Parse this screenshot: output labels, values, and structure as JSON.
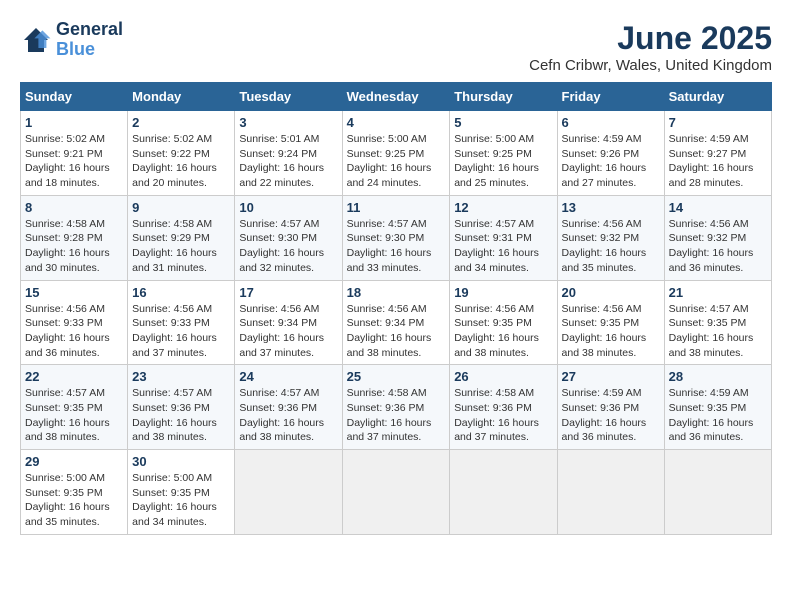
{
  "header": {
    "logo_line1": "General",
    "logo_line2": "Blue",
    "month": "June 2025",
    "location": "Cefn Cribwr, Wales, United Kingdom"
  },
  "weekdays": [
    "Sunday",
    "Monday",
    "Tuesday",
    "Wednesday",
    "Thursday",
    "Friday",
    "Saturday"
  ],
  "weeks": [
    [
      {
        "day": "1",
        "sunrise": "5:02 AM",
        "sunset": "9:21 PM",
        "daylight": "16 hours and 18 minutes."
      },
      {
        "day": "2",
        "sunrise": "5:02 AM",
        "sunset": "9:22 PM",
        "daylight": "16 hours and 20 minutes."
      },
      {
        "day": "3",
        "sunrise": "5:01 AM",
        "sunset": "9:24 PM",
        "daylight": "16 hours and 22 minutes."
      },
      {
        "day": "4",
        "sunrise": "5:00 AM",
        "sunset": "9:25 PM",
        "daylight": "16 hours and 24 minutes."
      },
      {
        "day": "5",
        "sunrise": "5:00 AM",
        "sunset": "9:25 PM",
        "daylight": "16 hours and 25 minutes."
      },
      {
        "day": "6",
        "sunrise": "4:59 AM",
        "sunset": "9:26 PM",
        "daylight": "16 hours and 27 minutes."
      },
      {
        "day": "7",
        "sunrise": "4:59 AM",
        "sunset": "9:27 PM",
        "daylight": "16 hours and 28 minutes."
      }
    ],
    [
      {
        "day": "8",
        "sunrise": "4:58 AM",
        "sunset": "9:28 PM",
        "daylight": "16 hours and 30 minutes."
      },
      {
        "day": "9",
        "sunrise": "4:58 AM",
        "sunset": "9:29 PM",
        "daylight": "16 hours and 31 minutes."
      },
      {
        "day": "10",
        "sunrise": "4:57 AM",
        "sunset": "9:30 PM",
        "daylight": "16 hours and 32 minutes."
      },
      {
        "day": "11",
        "sunrise": "4:57 AM",
        "sunset": "9:30 PM",
        "daylight": "16 hours and 33 minutes."
      },
      {
        "day": "12",
        "sunrise": "4:57 AM",
        "sunset": "9:31 PM",
        "daylight": "16 hours and 34 minutes."
      },
      {
        "day": "13",
        "sunrise": "4:56 AM",
        "sunset": "9:32 PM",
        "daylight": "16 hours and 35 minutes."
      },
      {
        "day": "14",
        "sunrise": "4:56 AM",
        "sunset": "9:32 PM",
        "daylight": "16 hours and 36 minutes."
      }
    ],
    [
      {
        "day": "15",
        "sunrise": "4:56 AM",
        "sunset": "9:33 PM",
        "daylight": "16 hours and 36 minutes."
      },
      {
        "day": "16",
        "sunrise": "4:56 AM",
        "sunset": "9:33 PM",
        "daylight": "16 hours and 37 minutes."
      },
      {
        "day": "17",
        "sunrise": "4:56 AM",
        "sunset": "9:34 PM",
        "daylight": "16 hours and 37 minutes."
      },
      {
        "day": "18",
        "sunrise": "4:56 AM",
        "sunset": "9:34 PM",
        "daylight": "16 hours and 38 minutes."
      },
      {
        "day": "19",
        "sunrise": "4:56 AM",
        "sunset": "9:35 PM",
        "daylight": "16 hours and 38 minutes."
      },
      {
        "day": "20",
        "sunrise": "4:56 AM",
        "sunset": "9:35 PM",
        "daylight": "16 hours and 38 minutes."
      },
      {
        "day": "21",
        "sunrise": "4:57 AM",
        "sunset": "9:35 PM",
        "daylight": "16 hours and 38 minutes."
      }
    ],
    [
      {
        "day": "22",
        "sunrise": "4:57 AM",
        "sunset": "9:35 PM",
        "daylight": "16 hours and 38 minutes."
      },
      {
        "day": "23",
        "sunrise": "4:57 AM",
        "sunset": "9:36 PM",
        "daylight": "16 hours and 38 minutes."
      },
      {
        "day": "24",
        "sunrise": "4:57 AM",
        "sunset": "9:36 PM",
        "daylight": "16 hours and 38 minutes."
      },
      {
        "day": "25",
        "sunrise": "4:58 AM",
        "sunset": "9:36 PM",
        "daylight": "16 hours and 37 minutes."
      },
      {
        "day": "26",
        "sunrise": "4:58 AM",
        "sunset": "9:36 PM",
        "daylight": "16 hours and 37 minutes."
      },
      {
        "day": "27",
        "sunrise": "4:59 AM",
        "sunset": "9:36 PM",
        "daylight": "16 hours and 36 minutes."
      },
      {
        "day": "28",
        "sunrise": "4:59 AM",
        "sunset": "9:35 PM",
        "daylight": "16 hours and 36 minutes."
      }
    ],
    [
      {
        "day": "29",
        "sunrise": "5:00 AM",
        "sunset": "9:35 PM",
        "daylight": "16 hours and 35 minutes."
      },
      {
        "day": "30",
        "sunrise": "5:00 AM",
        "sunset": "9:35 PM",
        "daylight": "16 hours and 34 minutes."
      },
      null,
      null,
      null,
      null,
      null
    ]
  ]
}
